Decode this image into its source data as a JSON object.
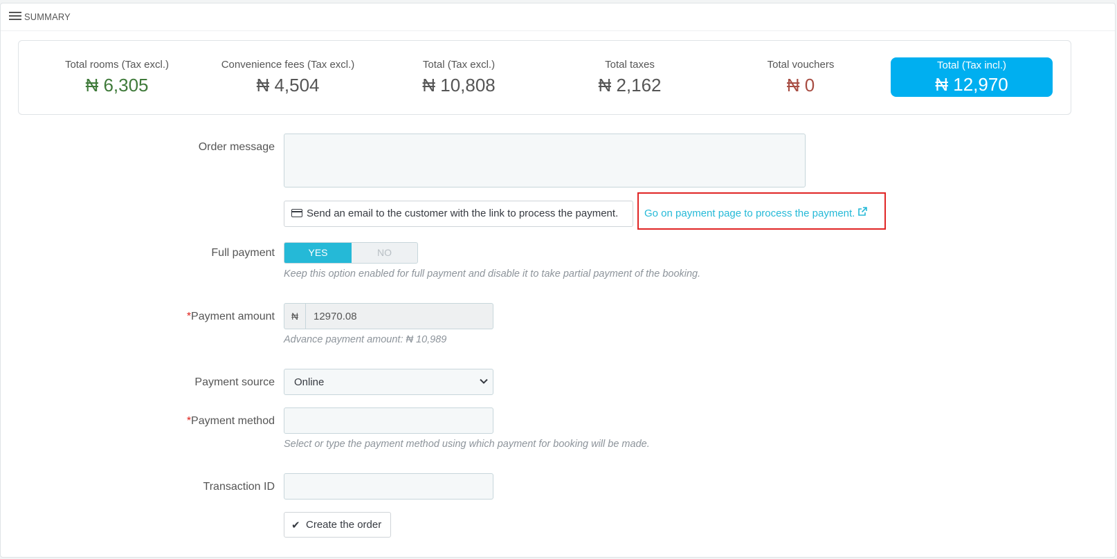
{
  "panel": {
    "title": "SUMMARY"
  },
  "summary": {
    "rooms": {
      "label": "Total rooms (Tax excl.)",
      "value": "₦ 6,305"
    },
    "fees": {
      "label": "Convenience fees (Tax excl.)",
      "value": "₦ 4,504"
    },
    "total_excl": {
      "label": "Total (Tax excl.)",
      "value": "₦ 10,808"
    },
    "taxes": {
      "label": "Total taxes",
      "value": "₦ 2,162"
    },
    "vouchers": {
      "label": "Total vouchers",
      "value": "₦ 0"
    },
    "total_incl": {
      "label": "Total (Tax incl.)",
      "value": "₦ 12,970"
    }
  },
  "form": {
    "order_message": {
      "label": "Order message",
      "value": ""
    },
    "email_button": {
      "label": "Send an email to the customer with the link to process the payment."
    },
    "payment_link": {
      "label": "Go on payment page to process the payment."
    },
    "full_payment": {
      "label": "Full payment",
      "yes": "YES",
      "no": "NO",
      "selected": "YES",
      "help": "Keep this option enabled for full payment and disable it to take partial payment of the booking."
    },
    "payment_amount": {
      "required_mark": "*",
      "label": "Payment amount",
      "currency": "₦",
      "value": "12970.08",
      "help": "Advance payment amount: ₦ 10,989"
    },
    "payment_source": {
      "label": "Payment source",
      "value": "Online"
    },
    "payment_method": {
      "required_mark": "*",
      "label": "Payment method",
      "value": "",
      "help": "Select or type the payment method using which payment for booking will be made."
    },
    "transaction_id": {
      "label": "Transaction ID",
      "value": ""
    },
    "create_button": {
      "label": "Create the order"
    }
  },
  "colors": {
    "accent": "#25b9d7",
    "total_highlight": "#00aff0",
    "positive": "#3f7a3a",
    "negative": "#a84d43",
    "required": "#e0211b",
    "focus_outline": "#e02424"
  },
  "icons": {
    "heading": "list-icon",
    "email_button": "credit-card-icon",
    "payment_link": "external-link-icon",
    "select": "chevron-down-icon",
    "create_button": "check-icon"
  }
}
